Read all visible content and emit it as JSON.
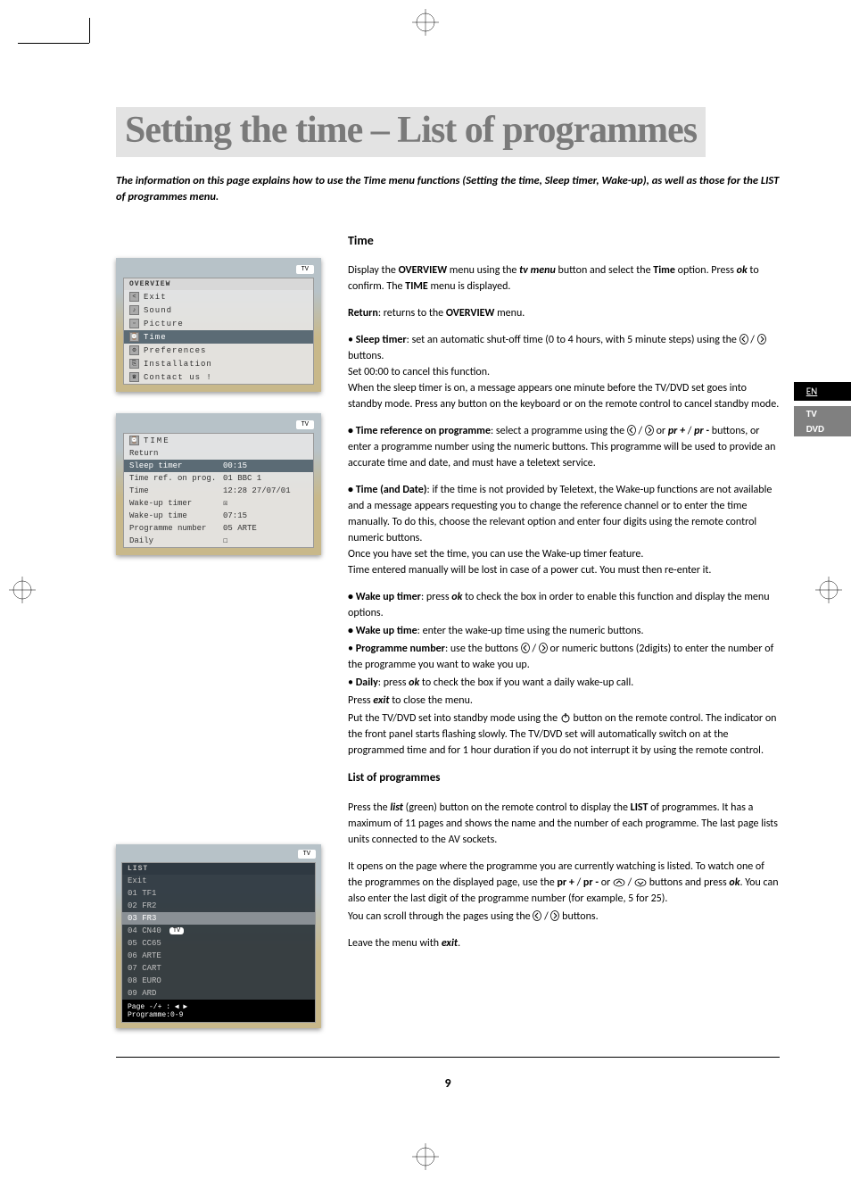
{
  "title": "Setting the time – List of programmes",
  "intro": "The information on this page explains how to use the Time menu functions (Setting the time, Sleep timer, Wake-up), as well as those for the LIST of programmes menu.",
  "sideTabs": {
    "en": "EN",
    "tv": "TV",
    "dvd": "DVD"
  },
  "pageNumber": "9",
  "osd1": {
    "tv": "TV",
    "title": "OVERVIEW",
    "items": [
      {
        "icon": "<",
        "label": "Exit"
      },
      {
        "icon": "♪",
        "label": "Sound"
      },
      {
        "icon": "▫",
        "label": "Picture"
      },
      {
        "icon": "⌚",
        "label": "Time",
        "selected": true
      },
      {
        "icon": "⚙",
        "label": "Preferences"
      },
      {
        "icon": "⎘",
        "label": "Installation"
      },
      {
        "icon": "☎",
        "label": "Contact us !"
      }
    ]
  },
  "osd2": {
    "tv": "TV",
    "icon": "⌚",
    "title": "TIME",
    "ret": "Return",
    "rows": [
      {
        "l": "Sleep timer",
        "r": "00:15",
        "sel": true
      },
      {
        "l": "Time ref. on prog.",
        "r": "01 BBC 1"
      },
      {
        "l": "Time",
        "r": "12:28 27/07/01"
      },
      {
        "l": "Wake-up timer",
        "r": "☒"
      },
      {
        "l": "Wake-up time",
        "r": "07:15"
      },
      {
        "l": "Programme number",
        "r": "05 ARTE"
      },
      {
        "l": "Daily",
        "r": "☐"
      }
    ]
  },
  "osd3": {
    "tv": "TV",
    "title": "LIST",
    "exit": "Exit",
    "items": [
      "01 TF1",
      "02 FR2",
      "03 FR3",
      "04 CN40",
      "05 CC65",
      "06 ARTE",
      "07 CART",
      "08 EURO",
      "09 ARD"
    ],
    "hlIndex": 2,
    "tvPill": "TV",
    "foot": "Page -/+ : ◀ ▶\nProgramme:0-9"
  },
  "content": {
    "h2_time": "Time",
    "p1a": "Display the ",
    "p1b": "OVERVIEW",
    "p1c": " menu using the ",
    "p1d": "tv menu",
    "p1e": " button and select the ",
    "p1f": "Time",
    "p1g": " option. Press ",
    "p1h": "ok",
    "p1i": " to confirm. The ",
    "p1j": "TIME",
    "p1k": " menu is displayed.",
    "p2a": "Return",
    "p2b": ": returns to the ",
    "p2c": "OVERVIEW",
    "p2d": " menu.",
    "p3a": "• ",
    "p3b": "Sleep timer",
    "p3c": ": set an automatic shut-off time (0 to 4 hours, with 5 minute steps) using the ",
    "p3d": " buttons.",
    "p3e": "Set 00:00 to cancel this function.",
    "p3f": "When the sleep timer is on, a message appears one minute before the TV/DVD set goes into standby mode. Press any button on the keyboard or on the remote control to cancel standby mode.",
    "p4a": "• Time reference on programme",
    "p4b": ": select a programme using the ",
    "p4c": " or ",
    "p4d": "pr +",
    "p4e": " / ",
    "p4f": "pr -",
    "p4g": " buttons, or enter a programme number using the numeric buttons. This programme will be used to provide an accurate time and date, and must have a teletext service.",
    "p5a": "• Time (and Date)",
    "p5b": ": if the time is not provided by Teletext, the Wake-up functions are not available and a message appears requesting you to change the reference channel or to enter the time manually. To do this, choose the relevant option and enter four digits using the remote control numeric buttons.",
    "p5c": "Once you have set the time, you can use the Wake-up timer feature.",
    "p5d": "Time entered manually will be lost in case of a power cut. You must then re-enter it.",
    "p6a": "• Wake up timer",
    "p6b": ": press ",
    "p6c": "ok",
    "p6d": " to check the box in order to enable this function and display the menu options.",
    "p7a": "• Wake up time",
    "p7b": ": enter the wake-up time using the numeric buttons.",
    "p8a": "• ",
    "p8b": "Programme number",
    "p8c": ": use the buttons ",
    "p8d": " or numeric buttons (2digits) to enter the number of the programme you want to wake you up.",
    "p9a": "• ",
    "p9b": "Daily",
    "p9c": ": press ",
    "p9d": "ok",
    "p9e": " to check the box if you want a daily wake-up call.",
    "p10a": "Press ",
    "p10b": "exit",
    "p10c": " to close the menu.",
    "p11a": "Put the TV/DVD set into standby mode using the ",
    "p11b": " button on the remote control. The indicator on the front panel starts flashing slowly. The TV/DVD set will automatically switch on at the programmed time and for 1 hour duration if you do not interrupt it by using the remote control.",
    "h3_list": "List of programmes",
    "pL1a": "Press the ",
    "pL1b": "list",
    "pL1c": " (green) button on the remote control to display the ",
    "pL1d": "LIST",
    "pL1e": " of programmes. It has a maximum of 11 pages and shows the name and the number of each programme. The last page lists units connected to the AV sockets.",
    "pL2a": "It opens on the page where the programme you are currently watching is listed. To watch one of the programmes on the displayed page, use the ",
    "pL2b": "pr +",
    "pL2c": " / ",
    "pL2d": "pr -",
    "pL2e": " or ",
    "pL2f": " buttons and press ",
    "pL2g": "ok",
    "pL2h": ".  You can also enter the last digit of the programme number (for example, 5 for 25).",
    "pL3a": "You can scroll through the pages using the ",
    "pL3b": " buttons.",
    "pL4a": "Leave the menu with ",
    "pL4b": "exit",
    "pL4c": "."
  }
}
